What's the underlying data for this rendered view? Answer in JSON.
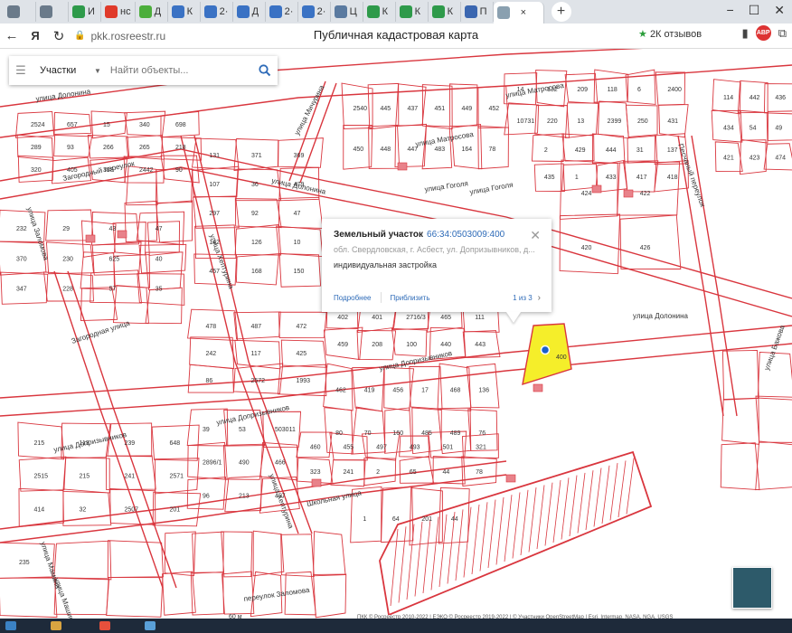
{
  "browser": {
    "tabs": [
      {
        "label": "",
        "color": "#6a7a8a"
      },
      {
        "label": "",
        "color": "#6a7a8a"
      },
      {
        "label": "И",
        "color": "#2e9a4a"
      },
      {
        "label": "нс",
        "color": "#e03a2a"
      },
      {
        "label": "Д",
        "color": "#4cae3c"
      },
      {
        "label": "К",
        "color": "#3a72c4"
      },
      {
        "label": "2·",
        "color": "#3a72c4"
      },
      {
        "label": "Д",
        "color": "#3a72c4"
      },
      {
        "label": "2·",
        "color": "#3a72c4"
      },
      {
        "label": "2·",
        "color": "#3a72c4"
      },
      {
        "label": "Ц",
        "color": "#5a7aa0"
      },
      {
        "label": "К",
        "color": "#2e9a4a"
      },
      {
        "label": "К",
        "color": "#2e9a4a"
      },
      {
        "label": "К",
        "color": "#2e9a4a"
      },
      {
        "label": "П",
        "color": "#3a66b0"
      },
      {
        "label": "",
        "color": "#8aa0b0",
        "active": true
      }
    ],
    "url": "pkk.rosreestr.ru",
    "page_title": "Публичная кадастровая карта",
    "reviews": "2К отзывов",
    "abp": "ABP"
  },
  "search": {
    "category": "Участки",
    "placeholder": "Найти объекты..."
  },
  "popup": {
    "title": "Земельный участок",
    "cadastral_number": "66:34:0503009:400",
    "address": "обл. Свердловская, г. Асбест, ул. Допризывников, д...",
    "usage": "индивидуальная застройка",
    "more_link": "Подробнее",
    "zoom_link": "Приблизить",
    "pager": "1 из 3"
  },
  "map": {
    "highlight_parcel": "400",
    "streets": [
      "улица Долонина",
      "Загородный переулок",
      "улица Матросова",
      "улица Мичурина",
      "улица Долонина",
      "улица Гоголя",
      "Песчаный переулок",
      "улица Хептурина",
      "улица Допризывников",
      "улица Допризывников",
      "улица Допризывников",
      "Загородная улица",
      "улица Заломова",
      "Школьная улица",
      "улица Мамина",
      "улица Машинистов",
      "переулок Заломова",
      "улица Хептурина",
      "улица Долонина",
      "улица Гоголя",
      "улица Матросова",
      "улица Бажова"
    ],
    "parcels": [
      "2524",
      "657",
      "15",
      "340",
      "698",
      "289",
      "93",
      "266",
      "265",
      "218",
      "320",
      "405",
      "318",
      "2442",
      "90",
      "232",
      "29",
      "43",
      "47",
      "370",
      "230",
      "625",
      "40",
      "347",
      "228",
      "57",
      "35",
      "131",
      "371",
      "369",
      "107",
      "36",
      "479",
      "297",
      "92",
      "47",
      "142",
      "126",
      "10",
      "457",
      "168",
      "150",
      "2540",
      "445",
      "437",
      "451",
      "449",
      "452",
      "450",
      "448",
      "447",
      "483",
      "164",
      "78",
      "14",
      "132",
      "209",
      "118",
      "6",
      "2400",
      "10731",
      "220",
      "13",
      "2399",
      "250",
      "431",
      "2",
      "429",
      "444",
      "31",
      "137",
      "435",
      "1",
      "433",
      "417",
      "418",
      "424",
      "422",
      "420",
      "426",
      "114",
      "442",
      "436",
      "434",
      "54",
      "49",
      "421",
      "423",
      "474",
      "478",
      "487",
      "472",
      "242",
      "117",
      "425",
      "86",
      "2572",
      "1993",
      "402",
      "401",
      "2716/3",
      "465",
      "111",
      "459",
      "208",
      "100",
      "440",
      "443",
      "462",
      "419",
      "456",
      "17",
      "468",
      "136",
      "80",
      "70",
      "160",
      "485",
      "489",
      "76",
      "215",
      "113",
      "239",
      "648",
      "2515",
      "215",
      "241",
      "2571",
      "414",
      "32",
      "2507",
      "201",
      "39",
      "53",
      "503011",
      "2896/1",
      "490",
      "466",
      "96",
      "213",
      "457",
      "460",
      "455",
      "497",
      "493",
      "501",
      "321",
      "323",
      "241",
      "2",
      "65",
      "44",
      "78",
      "1",
      "64",
      "201",
      "44",
      "235"
    ],
    "scale": "60 м",
    "attribution": "ПКК © Росреестр 2010-2022 | ЕЭКО © Росреестр 2019-2022 | © Участники OpenStreetMap | Esri, Intermap, NASA, NGA, USGS"
  },
  "colors": {
    "parcel_line": "#d9363e",
    "highlight_fill": "#f5ee2a",
    "building_fill": "#e8828a",
    "link": "#2e6bb8"
  }
}
